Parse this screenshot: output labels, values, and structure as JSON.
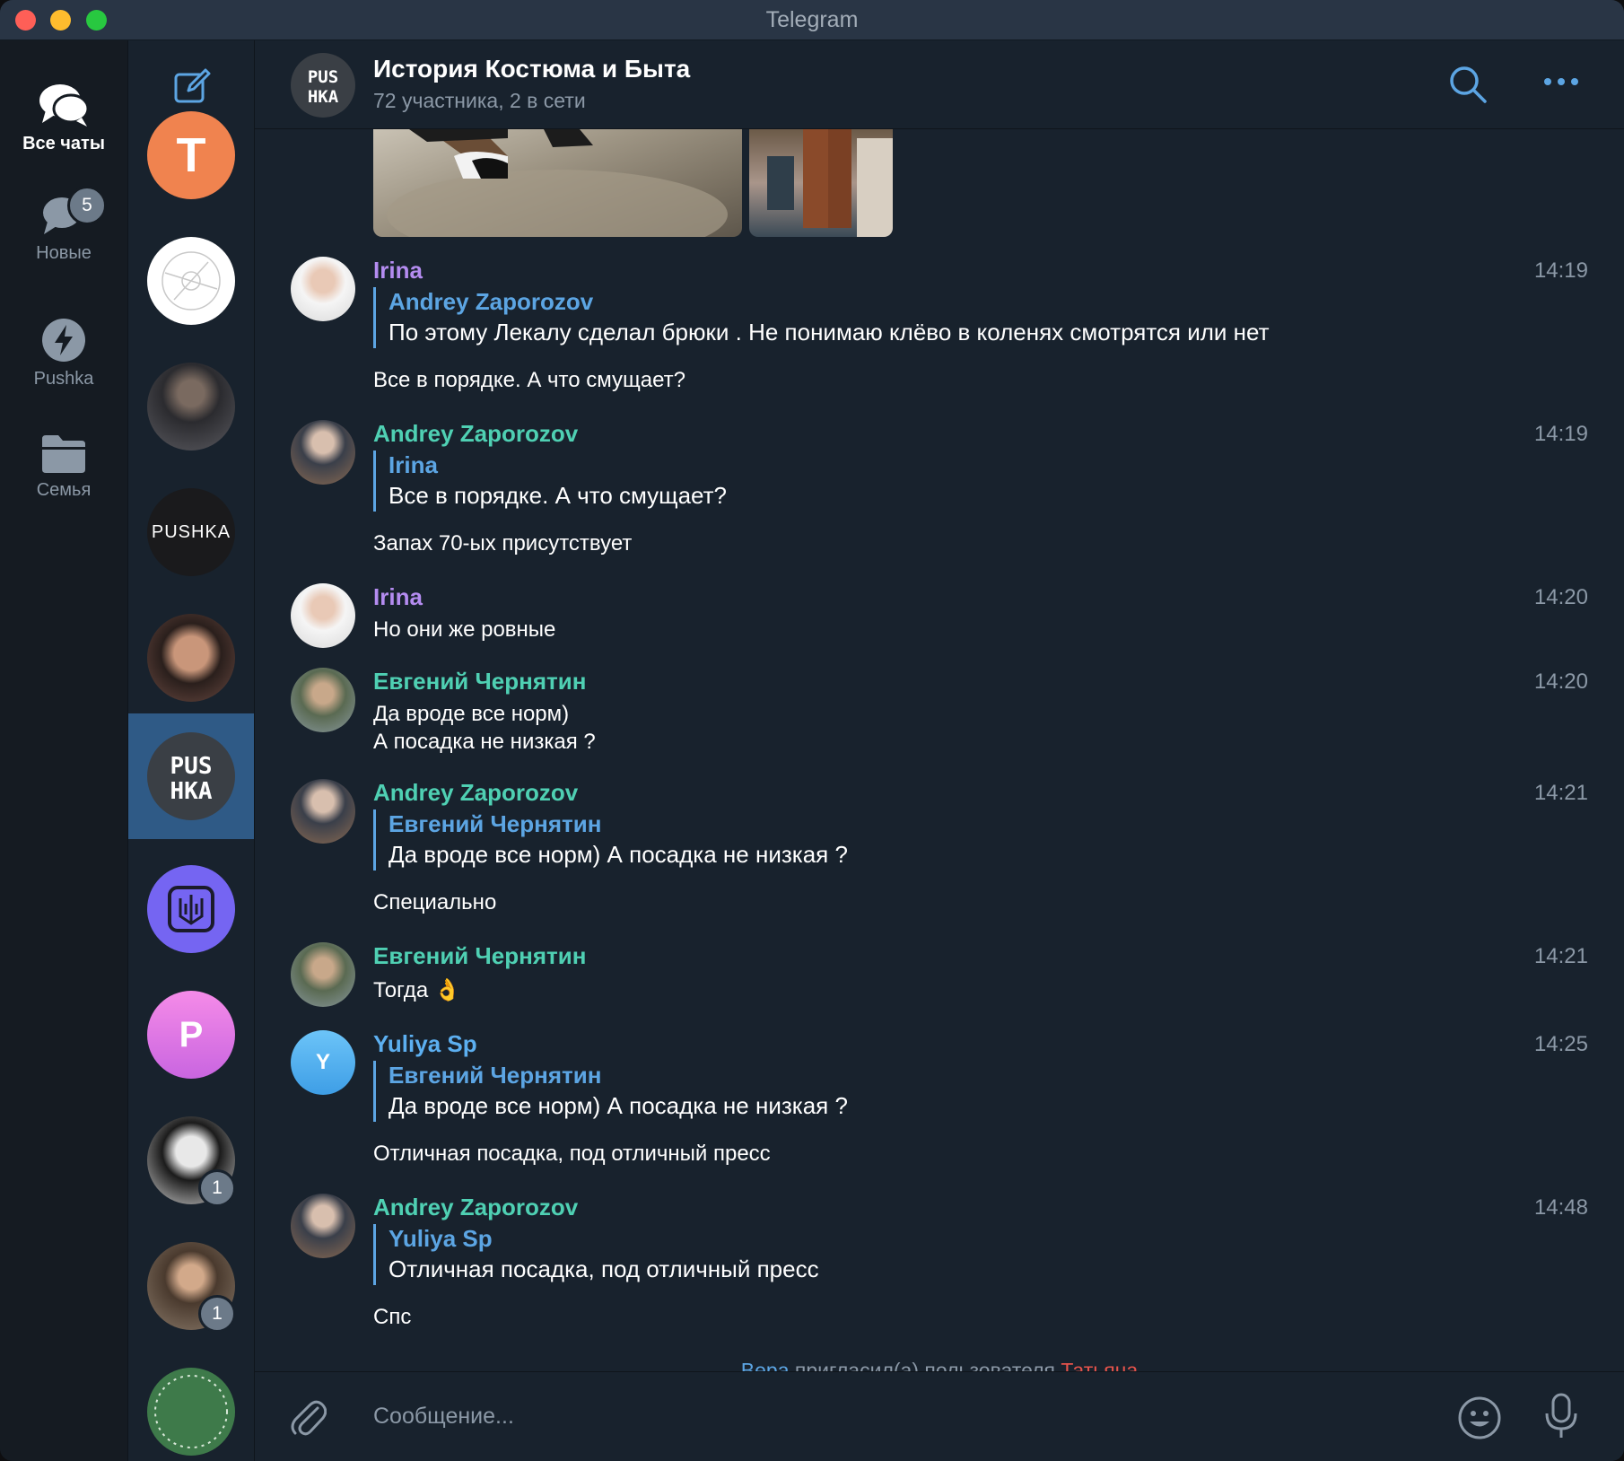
{
  "window": {
    "title": "Telegram"
  },
  "folders": [
    {
      "label": "Все чаты",
      "icon": "chat-bubbles-icon",
      "active": true
    },
    {
      "label": "Новые",
      "icon": "chat-bubble-icon",
      "badge": "5"
    },
    {
      "label": "Pushka",
      "icon": "bolt-icon"
    },
    {
      "label": "Семья",
      "icon": "folder-icon"
    }
  ],
  "chat_list": [
    {
      "avatar": "Т",
      "color": "#f0834f"
    },
    {
      "avatar": "",
      "color": "#ffffff"
    },
    {
      "avatar": "",
      "color": "#2b2b2f"
    },
    {
      "avatar": "PUSHKA",
      "color": "#1a1a1c"
    },
    {
      "avatar": "",
      "color": "#4a3b35"
    },
    {
      "avatar": "PUS HKA",
      "color": "#3a3f45",
      "selected": true
    },
    {
      "avatar": "",
      "color": "#7565f2"
    },
    {
      "avatar": "P",
      "color": "#e27be8"
    },
    {
      "avatar": "",
      "color": "#d9d9d9",
      "badge": "1"
    },
    {
      "avatar": "",
      "color": "#6b5a4a",
      "badge": "1"
    },
    {
      "avatar": "",
      "color": "#3e7a4a"
    }
  ],
  "header": {
    "title": "История Костюма и Быта",
    "subtitle": "72 участника, 2 в сети",
    "avatar_text": "PUS HKA"
  },
  "messages": [
    {
      "author": "Irina",
      "author_color": "#b48cf0",
      "time": "14:19",
      "reply": {
        "author": "Andrey Zaporozov",
        "text": "По этому Лекалу сделал брюки . Не понимаю клёво в коленях смотрятся или нет"
      },
      "text": "Все в порядке. А что смущает?"
    },
    {
      "author": "Andrey Zaporozov",
      "author_color": "#4fd0b3",
      "time": "14:19",
      "reply": {
        "author": "Irina",
        "text": "Все в порядке. А что смущает?"
      },
      "text": "Запах 70-ых присутствует"
    },
    {
      "author": "Irina",
      "author_color": "#b48cf0",
      "time": "14:20",
      "text": "Но они же ровные"
    },
    {
      "author": "Евгений Чернятин",
      "author_color": "#4fd0b3",
      "time": "14:20",
      "text_lines": [
        "Да вроде все норм)",
        "А посадка не низкая ?"
      ]
    },
    {
      "author": "Andrey Zaporozov",
      "author_color": "#4fd0b3",
      "time": "14:21",
      "reply": {
        "author": "Евгений Чернятин",
        "text": "Да вроде все норм) А посадка не низкая ?"
      },
      "text": "Специально"
    },
    {
      "author": "Евгений Чернятин",
      "author_color": "#4fd0b3",
      "time": "14:21",
      "text": "Тогда 👌"
    },
    {
      "author": "Yuliya Sp",
      "author_color": "#5caff0",
      "time": "14:25",
      "avatar_letter": "Y",
      "reply": {
        "author": "Евгений Чернятин",
        "text": "Да вроде все норм) А посадка не низкая ?"
      },
      "text": "Отличная посадка, под отличный пресс"
    },
    {
      "author": "Andrey Zaporozov",
      "author_color": "#4fd0b3",
      "time": "14:48",
      "reply": {
        "author": "Yuliya Sp",
        "text": "Отличная посадка, под отличный пресс"
      },
      "text": "Спс"
    }
  ],
  "service": {
    "actor": "Вера",
    "action": " пригласил(а) пользователя ",
    "target": "Татьяна"
  },
  "composer": {
    "placeholder": "Сообщение..."
  },
  "colors": {
    "accent": "#5ca5e3",
    "bg": "#18222d",
    "selected": "#2f5a86"
  }
}
